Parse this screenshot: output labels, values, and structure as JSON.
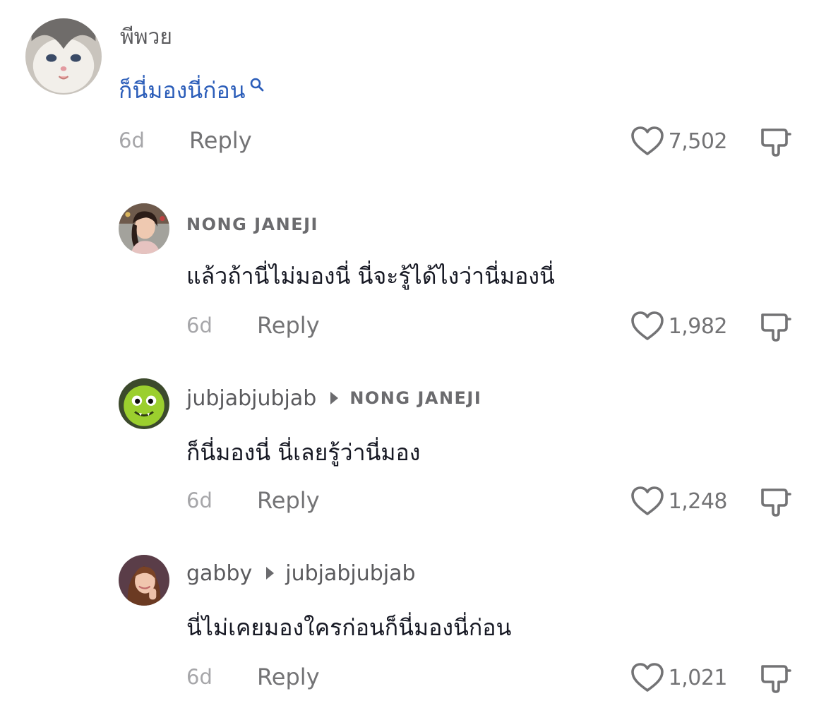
{
  "comments": [
    {
      "username": "พีพวย",
      "text": "ก็นี่มองนี่ก่อน",
      "time": "6d",
      "reply_label": "Reply",
      "likes": "7,502"
    },
    {
      "username": "NONG JANEJI",
      "text": "แล้วถ้านี่ไม่มองนี่ นี่จะรู้ได้ไงว่านี่มองนี่",
      "time": "6d",
      "reply_label": "Reply",
      "likes": "1,982"
    },
    {
      "username": "jubjabjubjab",
      "reply_to": "NONG JANEJI",
      "text": "ก็นี่มองนี่ นี่เลยรู้ว่านี่มอง",
      "time": "6d",
      "reply_label": "Reply",
      "likes": "1,248"
    },
    {
      "username": "gabby",
      "reply_to": "jubjabjubjab",
      "text": "นี่ไม่เคยมองใครก่อนก็นี่มองนี่ก่อน",
      "time": "6d",
      "reply_label": "Reply",
      "likes": "1,021"
    }
  ],
  "colors": {
    "link_text": "#2b5db9",
    "muted": "#737375",
    "timestamp": "#a6a6a9"
  },
  "icons": [
    "search-icon",
    "heart-icon",
    "dislike-icon",
    "reply-arrow-icon"
  ]
}
